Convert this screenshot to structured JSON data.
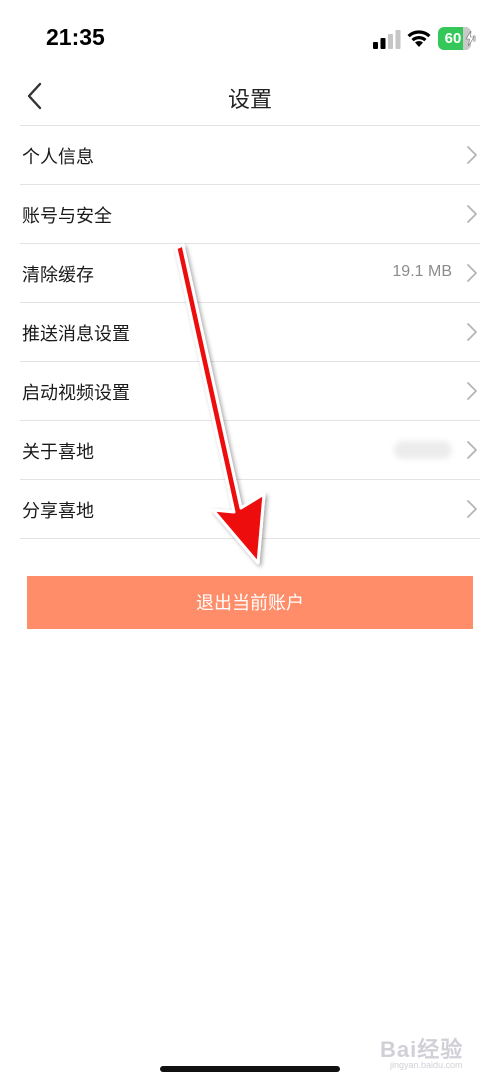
{
  "status_bar": {
    "time": "21:35",
    "battery_level": "60"
  },
  "nav": {
    "title": "设置"
  },
  "settings": {
    "items": [
      {
        "label": "个人信息",
        "value": ""
      },
      {
        "label": "账号与安全",
        "value": ""
      },
      {
        "label": "清除缓存",
        "value": "19.1 MB"
      },
      {
        "label": "推送消息设置",
        "value": ""
      },
      {
        "label": "启动视频设置",
        "value": ""
      },
      {
        "label": "关于喜地",
        "value": ""
      },
      {
        "label": "分享喜地",
        "value": ""
      }
    ]
  },
  "logout": {
    "label": "退出当前账户"
  },
  "watermark": {
    "brand": "Bai经验",
    "site": "jingyan.baidu.com"
  },
  "colors": {
    "accent": "#ff8d69",
    "arrow": "#ee1111",
    "battery": "#34c759"
  },
  "icons": {
    "back": "chevron-left-icon",
    "row": "chevron-right-icon",
    "signal": "signal-icon",
    "wifi": "wifi-icon",
    "battery": "battery-icon"
  }
}
